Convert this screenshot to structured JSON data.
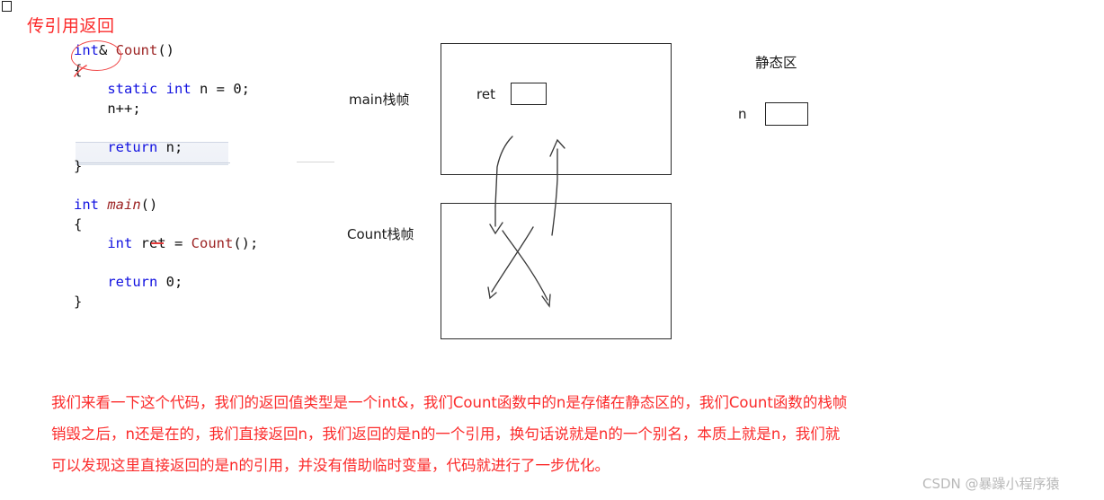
{
  "heading": {
    "text": "传引用返回"
  },
  "code": {
    "lines": [
      {
        "indent": 0,
        "tokens": [
          {
            "t": "int",
            "c": "kw"
          },
          {
            "t": "& ",
            "c": "plain"
          },
          {
            "t": "Count",
            "c": "fn"
          },
          {
            "t": "()",
            "c": "plain"
          }
        ]
      },
      {
        "indent": 0,
        "tokens": [
          {
            "t": "{",
            "c": "plain"
          }
        ]
      },
      {
        "indent": 4,
        "tokens": [
          {
            "t": "static int",
            "c": "kw"
          },
          {
            "t": " n = 0;",
            "c": "plain"
          }
        ]
      },
      {
        "indent": 4,
        "tokens": [
          {
            "t": "n++;",
            "c": "plain"
          }
        ]
      },
      {
        "indent": 0,
        "tokens": [
          {
            "t": " ",
            "c": "plain"
          }
        ]
      },
      {
        "indent": 4,
        "tokens": [
          {
            "t": "return",
            "c": "kw"
          },
          {
            "t": " n;",
            "c": "plain"
          }
        ]
      },
      {
        "indent": 0,
        "tokens": [
          {
            "t": "}",
            "c": "plain"
          }
        ]
      },
      {
        "indent": 0,
        "tokens": [
          {
            "t": " ",
            "c": "plain"
          }
        ]
      },
      {
        "indent": 0,
        "tokens": [
          {
            "t": "int",
            "c": "kw"
          },
          {
            "t": " ",
            "c": "plain"
          },
          {
            "t": "main",
            "c": "fn-it"
          },
          {
            "t": "()",
            "c": "plain"
          }
        ]
      },
      {
        "indent": 0,
        "tokens": [
          {
            "t": "{",
            "c": "plain"
          }
        ]
      },
      {
        "indent": 4,
        "tokens": [
          {
            "t": "int",
            "c": "kw"
          },
          {
            "t": " ret = ",
            "c": "plain"
          },
          {
            "t": "Count",
            "c": "fn"
          },
          {
            "t": "();",
            "c": "plain"
          }
        ]
      },
      {
        "indent": 0,
        "tokens": [
          {
            "t": " ",
            "c": "plain"
          }
        ]
      },
      {
        "indent": 4,
        "tokens": [
          {
            "t": "return",
            "c": "kw"
          },
          {
            "t": " 0;",
            "c": "plain"
          }
        ]
      },
      {
        "indent": 0,
        "tokens": [
          {
            "t": "}",
            "c": "plain"
          }
        ]
      }
    ],
    "selected_line_text": "return n;"
  },
  "diagram": {
    "main_frame_label": "main栈帧",
    "count_frame_label": "Count栈帧",
    "static_area_label": "静态区",
    "ret_var_label": "ret",
    "n_var_label": "n",
    "ret_value": "",
    "n_value": ""
  },
  "explanation": {
    "line1": "我们来看一下这个代码，我们的返回值类型是一个int&，我们Count函数中的n是存储在静态区的，我们Count函数的栈帧",
    "line2": "销毁之后，n还是在的，我们直接返回n，我们返回的是n的一个引用，换句话说就是n的一个别名，本质上就是n，我们就",
    "line3": "可以发现这里直接返回的是n的引用，并没有借助临时变量，代码就进行了一步优化。"
  },
  "watermark": {
    "text": "CSDN @暴躁小程序猿"
  },
  "colors": {
    "annotation_red": "#fb2b2b",
    "keyword_blue": "#1212e0",
    "function_maroon": "#9c2323",
    "box_border": "#2b2b2b",
    "watermark_gray": "#b9b9b9"
  }
}
